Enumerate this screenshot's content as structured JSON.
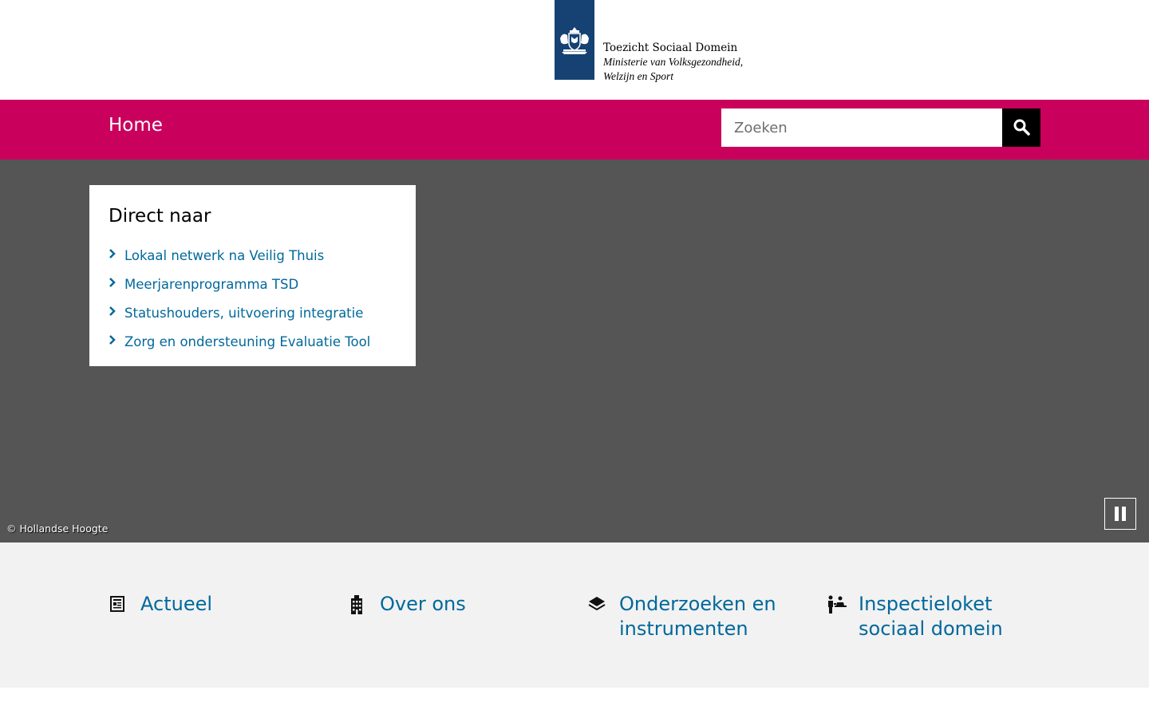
{
  "header": {
    "logo": {
      "title": "Toezicht Sociaal Domein",
      "subtitle_line1": "Ministerie van Volksgezondheid,",
      "subtitle_line2": "Welzijn en Sport",
      "emblem_icon": "dutch-coat-of-arms-icon"
    }
  },
  "nav": {
    "home_label": "Home",
    "search": {
      "placeholder": "Zoeken",
      "value": "",
      "button_icon": "search-icon"
    }
  },
  "hero": {
    "direct": {
      "title": "Direct naar",
      "links": [
        {
          "label": "Lokaal netwerk na Veilig Thuis"
        },
        {
          "label": "Meerjarenprogramma TSD"
        },
        {
          "label": "Statushouders, uitvoering integratie"
        },
        {
          "label": "Zorg en ondersteuning Evaluatie Tool"
        }
      ]
    },
    "credit": "© Hollandse Hoogte",
    "pause_icon": "pause-icon"
  },
  "band": {
    "items": [
      {
        "label_line1": "Actueel",
        "label_line2": "",
        "icon": "newspaper-icon"
      },
      {
        "label_line1": "Over ons",
        "label_line2": "",
        "icon": "building-icon"
      },
      {
        "label_line1": "Onderzoeken en",
        "label_line2": "instrumenten",
        "icon": "layers-icon"
      },
      {
        "label_line1": "Inspectieloket",
        "label_line2": "sociaal domein",
        "icon": "service-desk-icon"
      }
    ]
  },
  "colors": {
    "nav_background": "#ca005d",
    "logo_blue": "#154273",
    "link_blue": "#01689b",
    "hero_grey": "#555555",
    "band_grey": "#f2f2f2"
  }
}
